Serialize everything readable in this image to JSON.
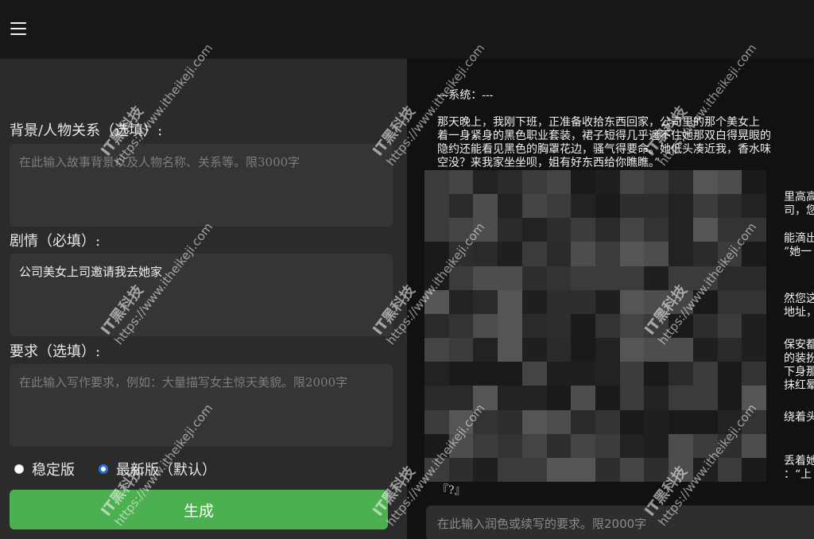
{
  "header": {
    "menu_icon": "hamburger-menu-icon"
  },
  "form": {
    "background_label": "背景/人物关系（选填）:",
    "background_placeholder": "在此输入故事背景以及人物名称、关系等。限3000字",
    "plot_label": "剧情（必填）:",
    "plot_value": "公司美女上司邀请我去她家",
    "requirements_label": "要求（选填）:",
    "requirements_placeholder": "在此输入写作要求，例如：大量描写女主惊天美貌。限2000字",
    "version_options": [
      {
        "label": "稳定版",
        "checked": false
      },
      {
        "label": "最新版（默认）",
        "checked": true
      }
    ],
    "generate_label": "生成"
  },
  "output": {
    "system_line": "---系统：---",
    "paragraph_lines": [
      "那天晚上，我刚下班，正准备收拾东西回家，公司里的那个美女上",
      "着一身紧身的黑色职业套装，裙子短得几乎遮不住她那双白得晃眼的",
      "隐约还能看见黑色的胸罩花边，骚气得要命。她低头凑近我，香水味",
      "空没？来我家坐坐呗，姐有好东西给你瞧瞧。”"
    ],
    "fragments": [
      [
        "里高高",
        "司，您"
      ],
      [
        "能滴出",
        "”她一"
      ],
      [
        "然您这",
        "地址，"
      ],
      [
        "保安都",
        "的装扮",
        "下身那",
        "抹红晕"
      ],
      [
        "绕着头"
      ],
      [
        "丢着她",
        "：“上"
      ]
    ],
    "tail": "『?』",
    "refine_placeholder": "在此输入润色或续写的要求。限2000字"
  },
  "watermark": {
    "brand": "IT黑科技",
    "url": "https://www.itheikeji.com"
  },
  "colors": {
    "accent": "#4caf50",
    "panel": "#2b2b2b",
    "radio_checked": "#2f6fd8"
  }
}
